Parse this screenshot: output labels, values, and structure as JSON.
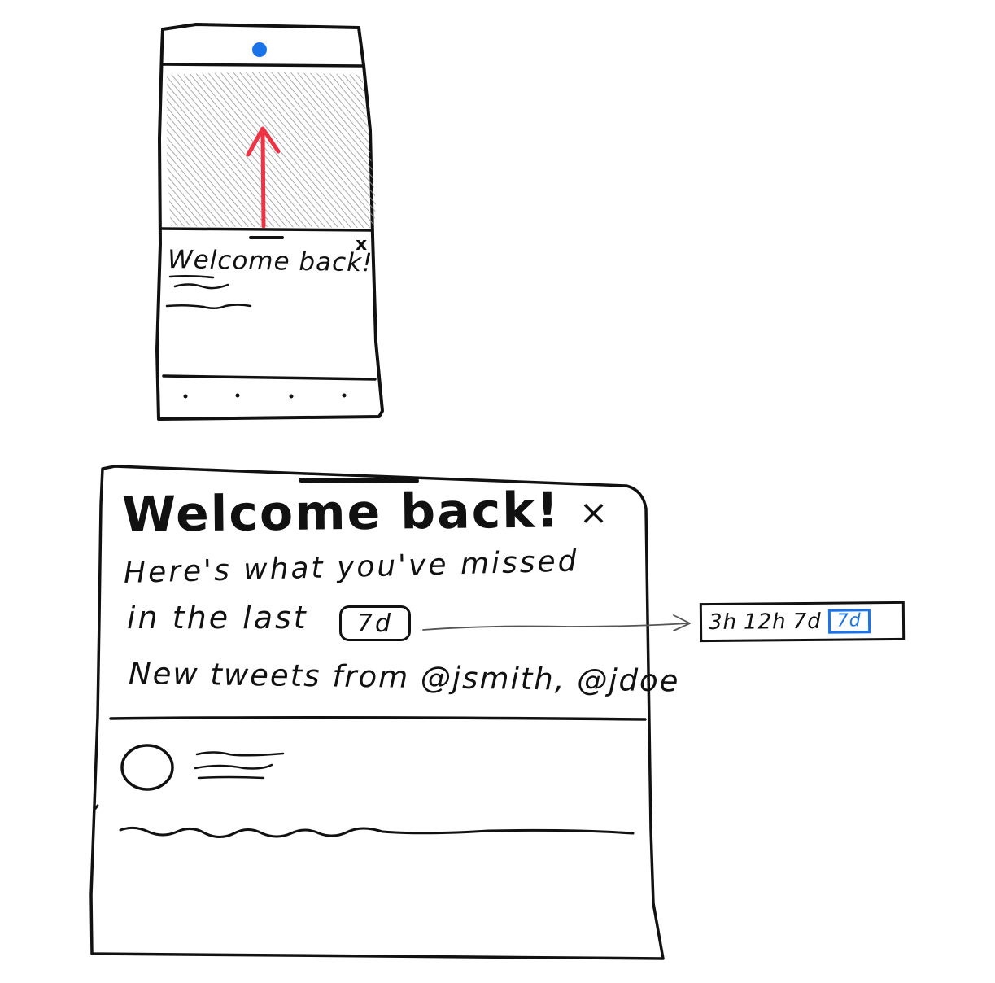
{
  "phone": {
    "notification_title": "Welcome back!",
    "close_glyph": "x",
    "accent_color": "#1a73e8",
    "swipe_arrow_color": "#ee3344"
  },
  "panel": {
    "title": "Welcome back!",
    "close_glyph": "×",
    "line1": "Here's what you've missed",
    "line2_prefix": "in the last",
    "selected_range": "7d",
    "line3": "New tweets from @jsmith, @jdoe"
  },
  "range_picker": {
    "options": [
      "3h",
      "12h",
      "7d"
    ],
    "selected": "7d",
    "selected_color": "#1a73e8"
  }
}
